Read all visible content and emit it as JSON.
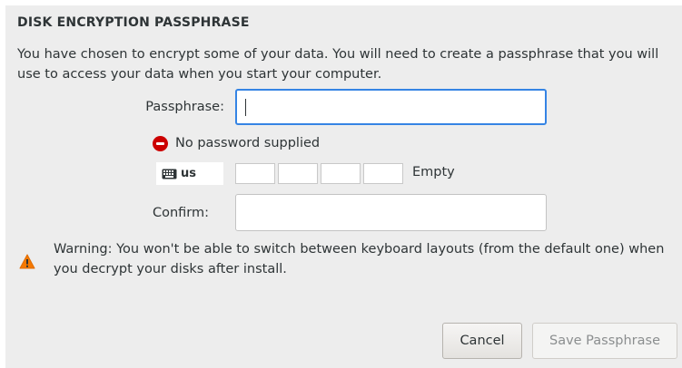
{
  "dialog": {
    "title": "DISK ENCRYPTION PASSPHRASE",
    "intro": "You have chosen to encrypt some of your data. You will need to create a passphrase that you will use to access your data when you start your computer."
  },
  "passphrase": {
    "label": "Passphrase:",
    "value": ""
  },
  "status": {
    "icon": "error-icon",
    "message": "No password supplied",
    "color": "#cc0000"
  },
  "keyboard": {
    "icon": "keyboard-icon",
    "layout": "us"
  },
  "strength": {
    "segments": 4,
    "level": 0,
    "label": "Empty"
  },
  "confirm": {
    "label": "Confirm:",
    "value": ""
  },
  "warning": {
    "icon": "warning-icon",
    "color": "#f57900",
    "text": "Warning: You won't be able to switch between keyboard layouts (from the default one) when you decrypt your disks after install."
  },
  "buttons": {
    "cancel": "Cancel",
    "save": "Save Passphrase",
    "save_enabled": false
  },
  "colors": {
    "accent": "#3584e4",
    "background": "#ededed"
  }
}
